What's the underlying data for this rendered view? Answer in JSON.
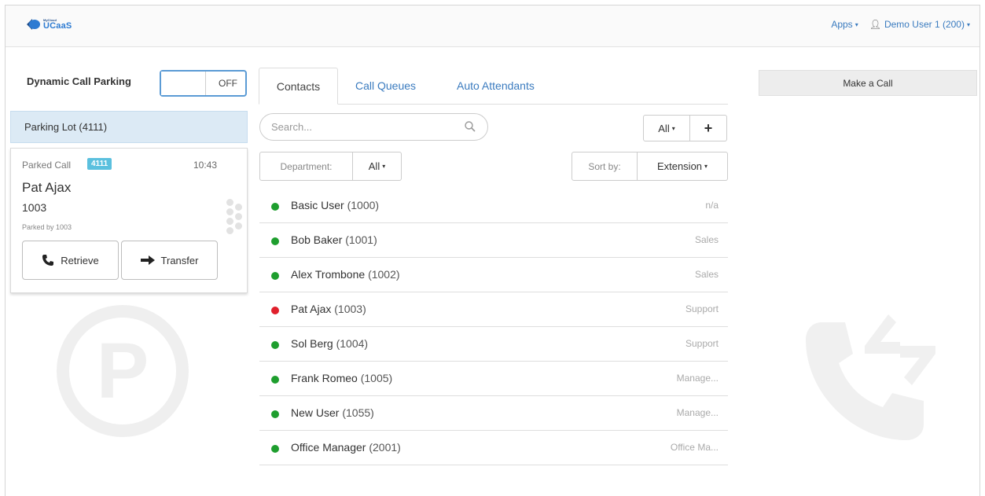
{
  "header": {
    "brand_small": "MyCloud",
    "brand": "UCaaS",
    "apps_label": "Apps",
    "user_label": "Demo User 1 (200)"
  },
  "parking": {
    "label": "Dynamic Call Parking",
    "toggle_state": "OFF",
    "lot_label": "Parking Lot (4111)",
    "card": {
      "title": "Parked Call",
      "badge": "4111",
      "time": "10:43",
      "name": "Pat Ajax",
      "extension": "1003",
      "parked_by": "Parked by 1003",
      "retrieve_label": "Retrieve",
      "transfer_label": "Transfer"
    }
  },
  "tabs": [
    {
      "label": "Contacts",
      "active": true
    },
    {
      "label": "Call Queues",
      "active": false
    },
    {
      "label": "Auto Attendants",
      "active": false
    }
  ],
  "search": {
    "placeholder": "Search..."
  },
  "filters": {
    "all_label": "All",
    "add_label": "+",
    "department_label": "Department:",
    "department_value": "All",
    "sort_label": "Sort by:",
    "sort_value": "Extension"
  },
  "contacts": [
    {
      "name": "Basic User",
      "ext": "(1000)",
      "dept": "n/a",
      "status": "green"
    },
    {
      "name": "Bob Baker",
      "ext": "(1001)",
      "dept": "Sales",
      "status": "green"
    },
    {
      "name": "Alex Trombone",
      "ext": "(1002)",
      "dept": "Sales",
      "status": "green"
    },
    {
      "name": "Pat Ajax",
      "ext": "(1003)",
      "dept": "Support",
      "status": "red"
    },
    {
      "name": "Sol Berg",
      "ext": "(1004)",
      "dept": "Support",
      "status": "green"
    },
    {
      "name": "Frank Romeo",
      "ext": "(1005)",
      "dept": "Manage...",
      "status": "green"
    },
    {
      "name": "New User",
      "ext": "(1055)",
      "dept": "Manage...",
      "status": "green"
    },
    {
      "name": "Office Manager",
      "ext": "(2001)",
      "dept": "Office Ma...",
      "status": "green"
    }
  ],
  "status_colors": {
    "green": "#1e9e2e",
    "red": "#e0202c"
  },
  "right": {
    "make_call_label": "Make a Call"
  }
}
